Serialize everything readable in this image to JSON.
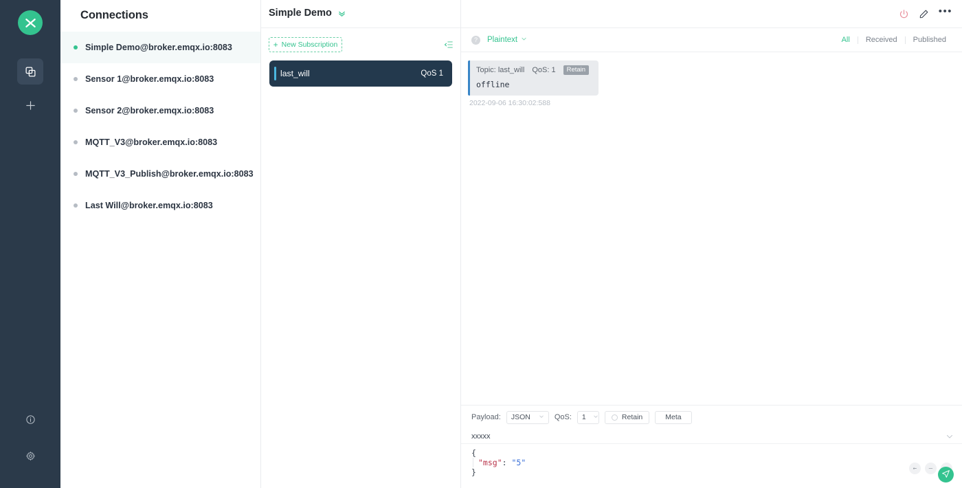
{
  "rail": {
    "logo_name": "emqx-logo",
    "items": [
      {
        "name": "connections-icon",
        "label": "Connections",
        "active": true
      },
      {
        "name": "new-connection-icon",
        "label": "New Connection",
        "active": false
      }
    ],
    "bottom": [
      {
        "name": "info-icon",
        "label": "About"
      },
      {
        "name": "settings-icon",
        "label": "Settings"
      }
    ]
  },
  "connections": {
    "title": "Connections",
    "items": [
      {
        "name": "Simple Demo@broker.emqx.io:8083",
        "online": true,
        "selected": true
      },
      {
        "name": "Sensor 1@broker.emqx.io:8083",
        "online": false,
        "selected": false
      },
      {
        "name": "Sensor 2@broker.emqx.io:8083",
        "online": false,
        "selected": false
      },
      {
        "name": "MQTT_V3@broker.emqx.io:8083",
        "online": false,
        "selected": false
      },
      {
        "name": "MQTT_V3_Publish@broker.emqx.io:8083",
        "online": false,
        "selected": false
      },
      {
        "name": "Last Will@broker.emqx.io:8083",
        "online": false,
        "selected": false
      }
    ]
  },
  "subscriptions": {
    "new_subscription_label": "New Subscription",
    "plus": "+",
    "collapse_icon": "collapse-list-icon",
    "items": [
      {
        "topic": "last_will",
        "qos": "QoS 1"
      }
    ]
  },
  "header": {
    "title": "Simple Demo",
    "chevron": "chevrons-down-icon",
    "actions": [
      {
        "name": "disconnect-icon",
        "label": "Disconnect"
      },
      {
        "name": "edit-icon",
        "label": "Edit"
      },
      {
        "name": "more-icon",
        "label": "More"
      }
    ],
    "more_dots": "•••"
  },
  "messages_toolbar": {
    "help_glyph": "?",
    "format": "Plaintext",
    "filters": [
      {
        "label": "All",
        "active": true
      },
      {
        "label": "Received",
        "active": false
      },
      {
        "label": "Published",
        "active": false
      }
    ]
  },
  "messages": [
    {
      "topic_label": "Topic:",
      "topic": "last_will",
      "qos_label": "QoS:",
      "qos": "1",
      "retain_label": "Retain",
      "payload": "offline",
      "time": "2022-09-06 16:30:02:588"
    }
  ],
  "publish": {
    "payload_label": "Payload:",
    "payload_format": "JSON",
    "qos_label": "QoS:",
    "qos_value": "1",
    "retain_label": "Retain",
    "meta_label": "Meta",
    "topic": "xxxxx",
    "editor_lines": [
      {
        "indent": false,
        "punc": "{"
      },
      {
        "indent": true,
        "key": "\"msg\"",
        "colon": ": ",
        "value": "\"5\""
      },
      {
        "indent": false,
        "punc": "}"
      }
    ],
    "actions": [
      {
        "name": "prev-icon",
        "glyph": "←"
      },
      {
        "name": "disabled-icon",
        "glyph": "–"
      },
      {
        "name": "next-icon",
        "glyph": "→"
      }
    ],
    "send_icon": "send-icon",
    "collapse_icon": "chevron-down-icon"
  },
  "colors": {
    "accent_green": "#34c38f",
    "rail_bg": "#2b3a4a",
    "sub_card_bg": "#23394d",
    "sub_accent": "#4bb7e0",
    "bubble_bg": "#e9ebee",
    "bubble_accent": "#3a86c8",
    "retain_badge": "#9aa1a9"
  }
}
